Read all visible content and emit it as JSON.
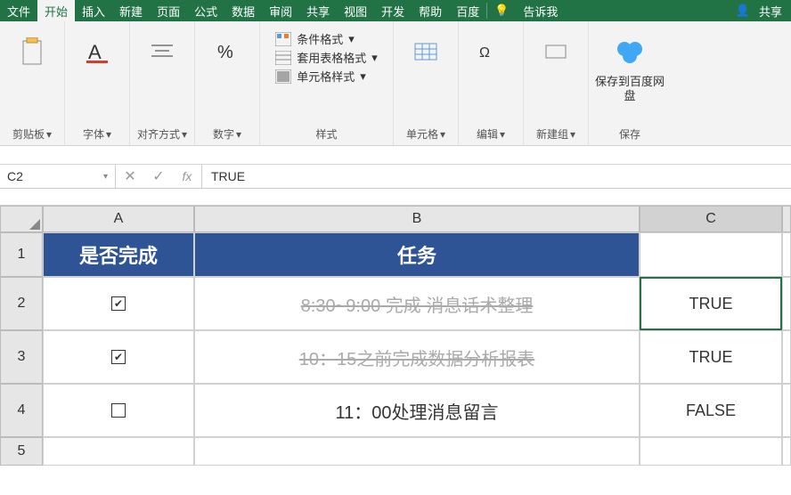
{
  "tabs": {
    "file": "文件",
    "home": "开始",
    "insert": "插入",
    "new": "新建",
    "page": "页面",
    "formula": "公式",
    "data": "数据",
    "review": "审阅",
    "share": "共享",
    "view": "视图",
    "dev": "开发",
    "help": "帮助",
    "baidu": "百度",
    "tellme": "告诉我",
    "shareBtn": "共享"
  },
  "ribbon": {
    "clip": "剪贴板",
    "font": "字体",
    "align": "对齐方式",
    "number": "数字",
    "style": {
      "group": "样式",
      "cond": "条件格式",
      "table": "套用表格格式",
      "cellstyle": "单元格样式"
    },
    "cell": "单元格",
    "edit": "编辑",
    "newgroup": "新建组",
    "save": {
      "label": "保存到百度网盘",
      "group": "保存"
    }
  },
  "formulaBar": {
    "name": "C2",
    "formula": "TRUE"
  },
  "table": {
    "headers": {
      "a": "是否完成",
      "b": "任务"
    },
    "rows": [
      {
        "done": true,
        "task": "8:30~9:00 完成 消息话术整理",
        "c": "TRUE"
      },
      {
        "done": true,
        "task": "10：15之前完成数据分析报表",
        "c": "TRUE"
      },
      {
        "done": false,
        "task": "11：00处理消息留言",
        "c": "FALSE"
      }
    ]
  },
  "cols": [
    "A",
    "B",
    "C"
  ],
  "rowNums": [
    "1",
    "2",
    "3",
    "4",
    "5"
  ]
}
